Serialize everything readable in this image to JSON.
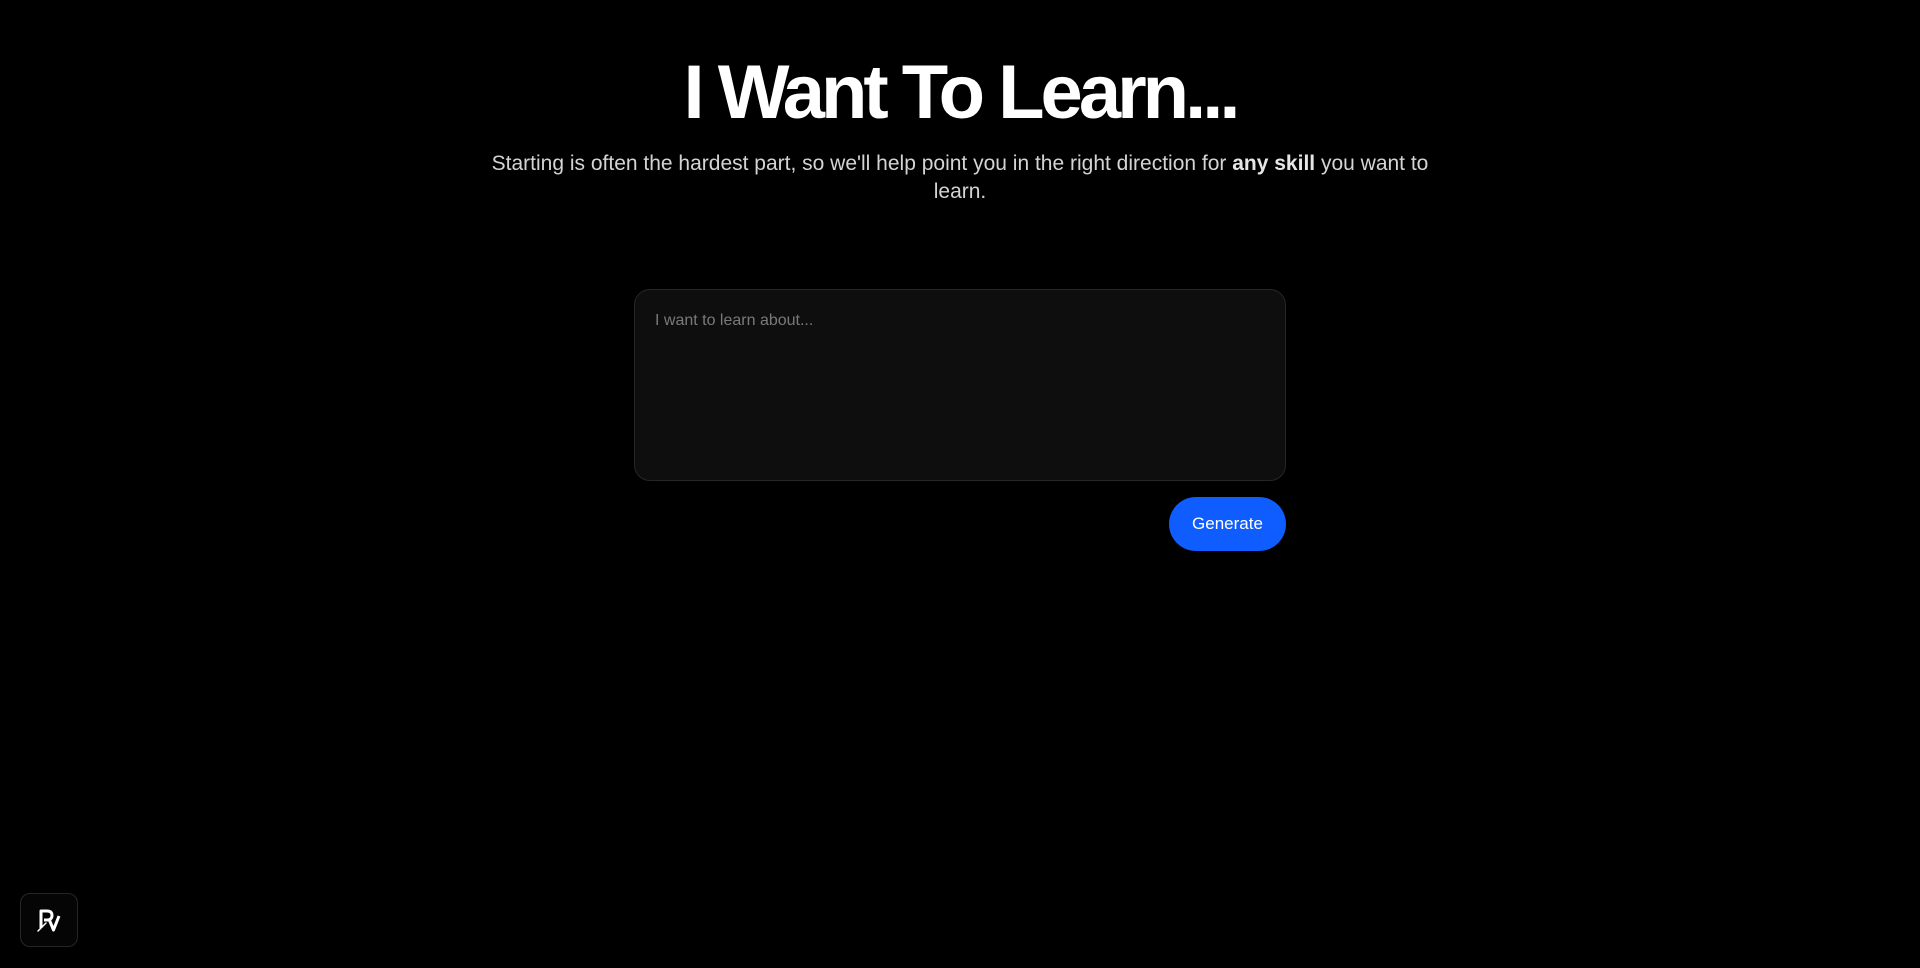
{
  "hero": {
    "title": "I Want To Learn...",
    "subtitle_before": "Starting is often the hardest part, so we'll help point you in the right direction for ",
    "subtitle_emphasis": "any skill",
    "subtitle_after": " you want to learn."
  },
  "form": {
    "input_placeholder": "I want to learn about...",
    "input_value": "",
    "generate_label": "Generate"
  },
  "badge": {
    "logo_text": "PV",
    "icon": "pv-logo-icon"
  },
  "colors": {
    "background": "#000000",
    "accent": "#0f5cff",
    "input_background": "#0e0e0e"
  }
}
